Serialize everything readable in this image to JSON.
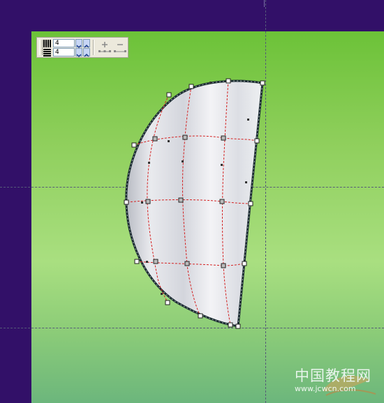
{
  "toolbar": {
    "columns_value": "4",
    "rows_value": "4",
    "columns_icon": "columns-icon",
    "rows_icon": "rows-icon",
    "add_node_icon": "add-node-icon",
    "delete_node_icon": "delete-node-icon"
  },
  "colors": {
    "frame": "#321068",
    "canvas_top": "#6cc238",
    "canvas_bottom": "#6cb67c",
    "shape_fill": "#e8e8ec",
    "shape_outline": "#1a2a30",
    "mesh_lines": "#d42020",
    "guides": "#555a78"
  },
  "watermark": {
    "title": "中国教程网",
    "url": "www.jcwcn.com"
  }
}
